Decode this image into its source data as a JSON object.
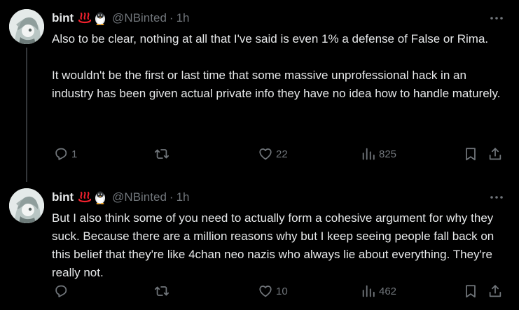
{
  "tweets": [
    {
      "author": {
        "name": "bint",
        "emojis": [
          "hot-springs-emoji",
          "penguin-emoji"
        ],
        "handle": "@NBinted"
      },
      "separator": "·",
      "time": "1h",
      "body": [
        "Also to be clear, nothing at all that I've said is even 1% a defense of False or Rima.",
        "It wouldn't be the first or last time that some massive unprofessional hack in an industry has been given actual private info they have no idea how to handle maturely."
      ],
      "stats": {
        "replies": "1",
        "retweets": "",
        "likes": "22",
        "views": "825"
      }
    },
    {
      "author": {
        "name": "bint",
        "emojis": [
          "hot-springs-emoji",
          "penguin-emoji"
        ],
        "handle": "@NBinted"
      },
      "separator": "·",
      "time": "1h",
      "body": [
        "But I also think some of you need to actually form a cohesive argument for why they suck. Because there are a million reasons why but I keep seeing people fall back on this belief that they're like 4chan neo nazis who always lie about everything. They're really not."
      ],
      "stats": {
        "replies": "",
        "retweets": "",
        "likes": "10",
        "views": "462"
      }
    }
  ],
  "colors": {
    "background": "#000000",
    "text": "#e7e9ea",
    "secondary": "#71767b",
    "thread_line": "#333639",
    "hot_springs": "#f4212e"
  }
}
